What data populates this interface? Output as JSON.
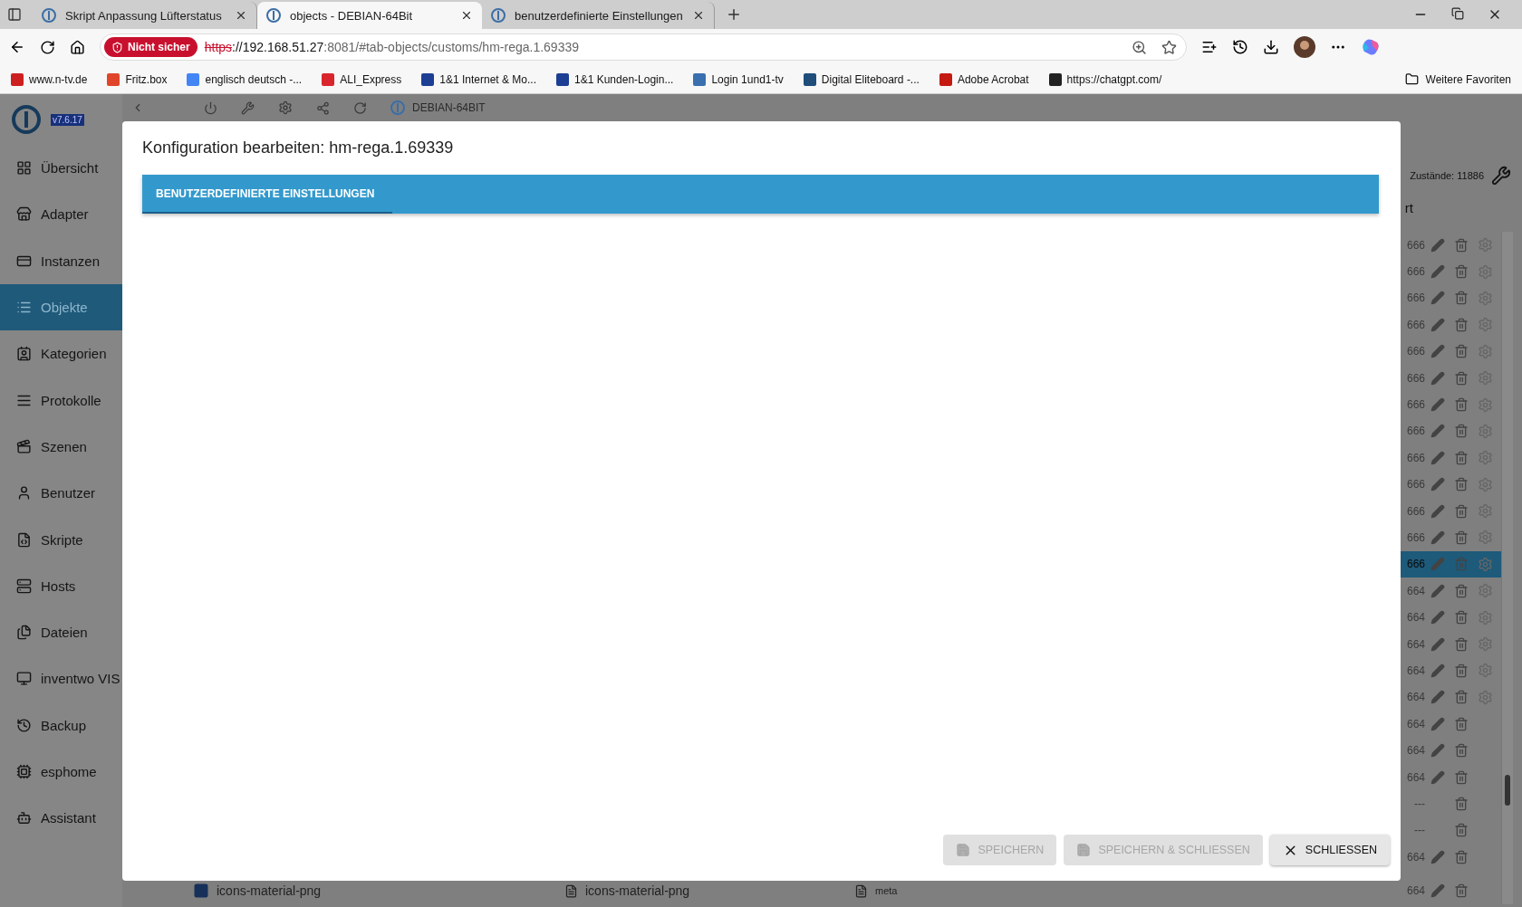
{
  "browser": {
    "tabs": [
      {
        "title": "Skript Anpassung Lüfterstatus",
        "selected": false
      },
      {
        "title": "objects - DEBIAN-64Bit",
        "selected": true
      },
      {
        "title": "benutzerdefinierte Einstellungen",
        "selected": false
      }
    ],
    "address": {
      "security": "Nicht sicher",
      "scheme": "https",
      "host": "://192.168.51.27",
      "path": ":8081/#tab-objects/customs/hm-rega.1.69339"
    },
    "bookmarks": [
      {
        "label": "www.n-tv.de",
        "color": "#cc1f1f"
      },
      {
        "label": "Fritz.box",
        "color": "#e0452a"
      },
      {
        "label": "englisch deutsch -...",
        "color": "#4285f4"
      },
      {
        "label": "ALI_Express",
        "color": "#d9262c"
      },
      {
        "label": "1&1 Internet & Mo...",
        "color": "#1c3f94"
      },
      {
        "label": "1&1 Kunden-Login...",
        "color": "#1c3f94"
      },
      {
        "label": "Login 1und1-tv",
        "color": "#3a6fb0"
      },
      {
        "label": "Digital Eliteboard -...",
        "color": "#1f4e7a"
      },
      {
        "label": "Adobe Acrobat",
        "color": "#c41a12"
      },
      {
        "label": "https://chatgpt.com/",
        "color": "#222222"
      }
    ],
    "more_bookmarks": "Weitere Favoriten"
  },
  "app": {
    "version": "v7.6.17",
    "host": "DEBIAN-64BIT",
    "sidebar": [
      {
        "label": "Übersicht",
        "selected": false
      },
      {
        "label": "Adapter",
        "selected": false
      },
      {
        "label": "Instanzen",
        "selected": false
      },
      {
        "label": "Objekte",
        "selected": true
      },
      {
        "label": "Kategorien",
        "selected": false
      },
      {
        "label": "Protokolle",
        "selected": false
      },
      {
        "label": "Szenen",
        "selected": false
      },
      {
        "label": "Benutzer",
        "selected": false
      },
      {
        "label": "Skripte",
        "selected": false
      },
      {
        "label": "Hosts",
        "selected": false
      },
      {
        "label": "Dateien",
        "selected": false
      },
      {
        "label": "inventwo VIS",
        "selected": false
      },
      {
        "label": "Backup",
        "selected": false
      },
      {
        "label": "esphome",
        "selected": false
      },
      {
        "label": "Assistant",
        "selected": false
      }
    ],
    "states_count": "Zustände: 11886",
    "column_header": "rt",
    "rows": [
      {
        "value": "666",
        "kind": "full",
        "selected": false
      },
      {
        "value": "666",
        "kind": "full",
        "selected": false
      },
      {
        "value": "666",
        "kind": "full",
        "selected": false
      },
      {
        "value": "666",
        "kind": "full",
        "selected": false
      },
      {
        "value": "666",
        "kind": "full",
        "selected": false
      },
      {
        "value": "666",
        "kind": "full",
        "selected": false
      },
      {
        "value": "666",
        "kind": "full",
        "selected": false
      },
      {
        "value": "666",
        "kind": "full",
        "selected": false
      },
      {
        "value": "666",
        "kind": "full",
        "selected": false
      },
      {
        "value": "666",
        "kind": "full",
        "selected": false
      },
      {
        "value": "666",
        "kind": "full",
        "selected": false
      },
      {
        "value": "666",
        "kind": "full",
        "selected": false
      },
      {
        "value": "666",
        "kind": "full",
        "selected": true
      },
      {
        "value": "664",
        "kind": "full",
        "selected": false
      },
      {
        "value": "664",
        "kind": "full",
        "selected": false
      },
      {
        "value": "664",
        "kind": "full",
        "selected": false
      },
      {
        "value": "664",
        "kind": "full",
        "selected": false
      },
      {
        "value": "664",
        "kind": "full",
        "selected": false
      },
      {
        "value": "664",
        "kind": "nogear",
        "selected": false
      },
      {
        "value": "664",
        "kind": "nogear",
        "selected": false
      },
      {
        "value": "664",
        "kind": "nogear",
        "selected": false
      },
      {
        "value": "---",
        "kind": "trash",
        "selected": false
      },
      {
        "value": "---",
        "kind": "trash",
        "selected": false
      },
      {
        "value": "664",
        "kind": "nogear",
        "selected": false
      },
      {
        "value": "664",
        "kind": "nogear",
        "selected": false,
        "name": "icons-material-png",
        "name2": "icons-material-png",
        "type": "meta"
      }
    ]
  },
  "dialog": {
    "title": "Konfiguration bearbeiten: hm-rega.1.69339",
    "tabs": [
      {
        "label": "BENUTZERDEFINIERTE EINSTELLUNGEN",
        "selected": true
      }
    ],
    "buttons": [
      {
        "label": "SPEICHERN",
        "kind": "save",
        "disabled": true
      },
      {
        "label": "SPEICHERN & SCHLIESSEN",
        "kind": "save",
        "disabled": true
      },
      {
        "label": "SCHLIESSEN",
        "kind": "close",
        "disabled": false
      }
    ]
  }
}
